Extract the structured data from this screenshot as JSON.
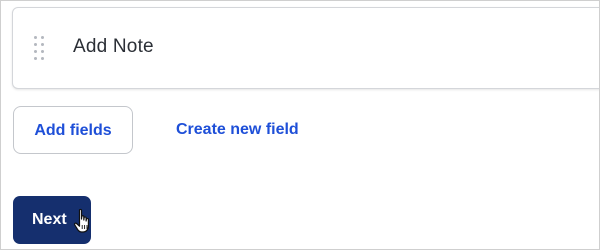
{
  "field_card": {
    "label": "Add Note",
    "drag_handle_icon": "drag-handle-icon"
  },
  "actions": {
    "add_fields_label": "Add fields",
    "create_new_field_label": "Create new field"
  },
  "footer": {
    "next_label": "Next",
    "cursor_icon": "hand-pointer-icon"
  },
  "colors": {
    "link_blue": "#1e4fd8",
    "primary_navy": "#152f6e",
    "border_gray": "#c4c7cc"
  }
}
